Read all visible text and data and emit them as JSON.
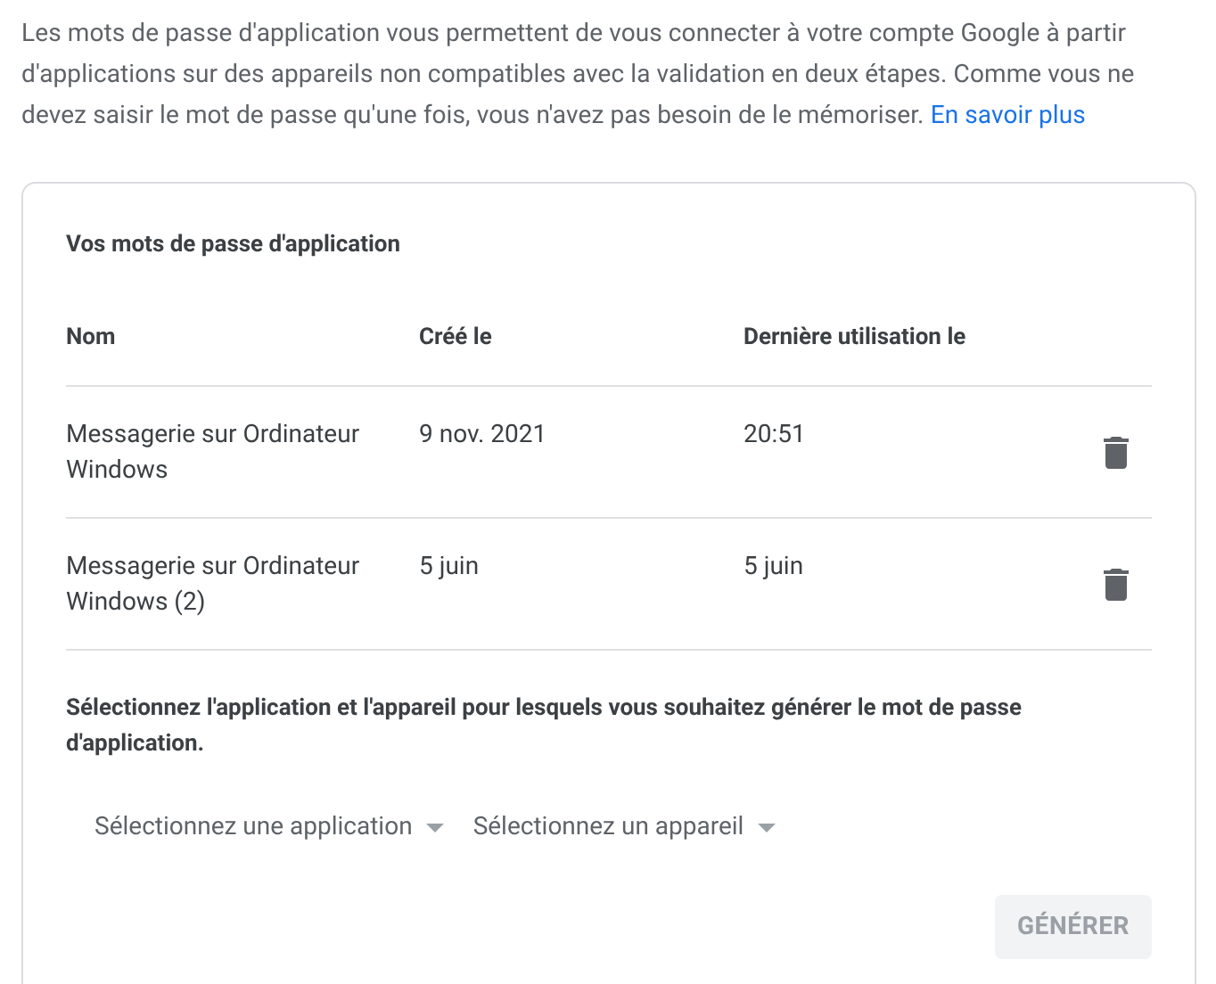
{
  "intro": {
    "text": "Les mots de passe d'application vous permettent de vous connecter à votre compte Google à partir d'applications sur des appareils non compatibles avec la validation en deux étapes. Comme vous ne devez saisir le mot de passe qu'une fois, vous n'avez pas besoin de le mémoriser.",
    "link": "En savoir plus"
  },
  "card": {
    "title": "Vos mots de passe d'application",
    "table": {
      "columns": [
        "Nom",
        "Créé le",
        "Dernière utilisation le"
      ],
      "rows": [
        {
          "name": "Messagerie sur Ordinateur Windows",
          "created": "9 nov. 2021",
          "last_used": "20:51"
        },
        {
          "name": "Messagerie sur Ordinateur Windows (2)",
          "created": "5 juin",
          "last_used": "5 juin"
        }
      ]
    },
    "prompt": "Sélectionnez l'application et l'appareil pour lesquels vous souhaitez générer le mot de passe d'application.",
    "dropdowns": [
      {
        "label": "Sélectionnez une application"
      },
      {
        "label": "Sélectionnez un appareil"
      }
    ],
    "generate_button": {
      "label": "GÉNÉRER",
      "disabled": true
    }
  }
}
